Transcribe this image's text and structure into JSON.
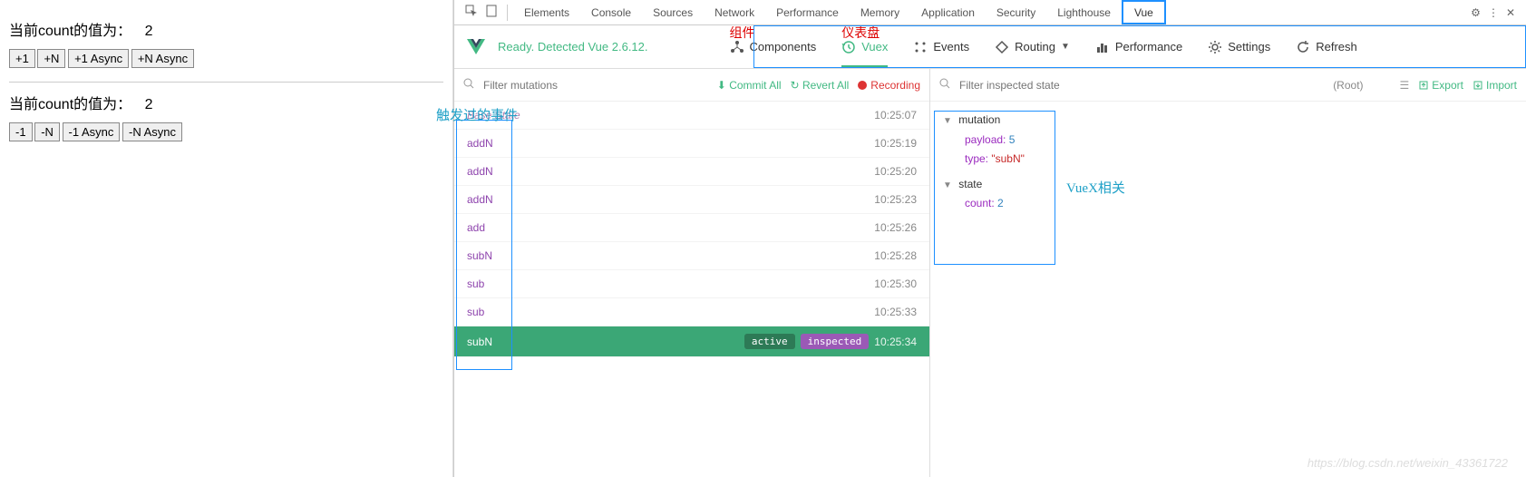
{
  "app": {
    "countLabel1": "当前count的值为：",
    "countValue1": "2",
    "buttonsAdd": [
      "+1",
      "+N",
      "+1 Async",
      "+N Async"
    ],
    "countLabel2": "当前count的值为：",
    "countValue2": "2",
    "buttonsSub": [
      "-1",
      "-N",
      "-1 Async",
      "-N Async"
    ]
  },
  "devtoolsTabs": [
    "Elements",
    "Console",
    "Sources",
    "Network",
    "Performance",
    "Memory",
    "Application",
    "Security",
    "Lighthouse",
    "Vue"
  ],
  "vueBar": {
    "ready": "Ready. Detected Vue 2.6.12.",
    "nav": [
      {
        "label": "Components",
        "anno": "组件"
      },
      {
        "label": "Vuex",
        "anno": "仪表盘"
      },
      {
        "label": "Events"
      },
      {
        "label": "Routing"
      },
      {
        "label": "Performance"
      },
      {
        "label": "Settings"
      },
      {
        "label": "Refresh"
      }
    ]
  },
  "mutFilter": {
    "placeholder": "Filter mutations",
    "commit": "Commit All",
    "revert": "Revert All",
    "recording": "Recording"
  },
  "mutations": [
    {
      "name": "Base State",
      "time": "10:25:07",
      "base": true
    },
    {
      "name": "addN",
      "time": "10:25:19"
    },
    {
      "name": "addN",
      "time": "10:25:20"
    },
    {
      "name": "addN",
      "time": "10:25:23"
    },
    {
      "name": "add",
      "time": "10:25:26"
    },
    {
      "name": "subN",
      "time": "10:25:28"
    },
    {
      "name": "sub",
      "time": "10:25:30"
    },
    {
      "name": "sub",
      "time": "10:25:33"
    },
    {
      "name": "subN",
      "time": "10:25:34",
      "selected": true,
      "badges": [
        "active",
        "inspected"
      ]
    }
  ],
  "stateFilter": {
    "placeholder": "Filter inspected state",
    "root": "(Root)",
    "export": "Export",
    "import": "Import"
  },
  "stateTree": {
    "mutationLabel": "mutation",
    "payloadKey": "payload:",
    "payloadVal": "5",
    "typeKey": "type:",
    "typeVal": "\"subN\"",
    "stateLabel": "state",
    "countKey": "count:",
    "countVal": "2"
  },
  "annotations": {
    "triggered": "触发过的事件",
    "vuexRelated": "VueX相关"
  },
  "watermark": "https://blog.csdn.net/weixin_43361722"
}
